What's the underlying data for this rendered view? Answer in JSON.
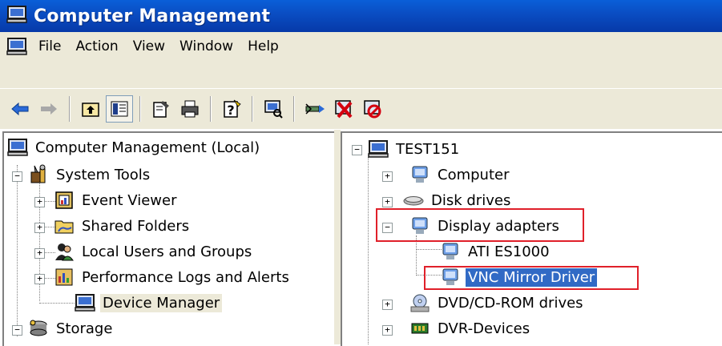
{
  "window": {
    "title": "Computer Management"
  },
  "menu": {
    "items": [
      "File",
      "Action",
      "View",
      "Window",
      "Help"
    ]
  },
  "left_tree": {
    "root": "Computer Management (Local)",
    "system_tools": "System Tools",
    "children": [
      "Event Viewer",
      "Shared Folders",
      "Local Users and Groups",
      "Performance Logs and Alerts",
      "Device Manager"
    ],
    "storage": "Storage"
  },
  "right_tree": {
    "root": "TEST151",
    "items": [
      "Computer",
      "Disk drives",
      "Display adapters",
      "ATI ES1000",
      "VNC Mirror Driver",
      "DVD/CD-ROM drives",
      "DVR-Devices"
    ]
  },
  "colors": {
    "selection": "#316ac5",
    "annotation": "#e0202a",
    "titlebar": "#0a4ec4"
  }
}
